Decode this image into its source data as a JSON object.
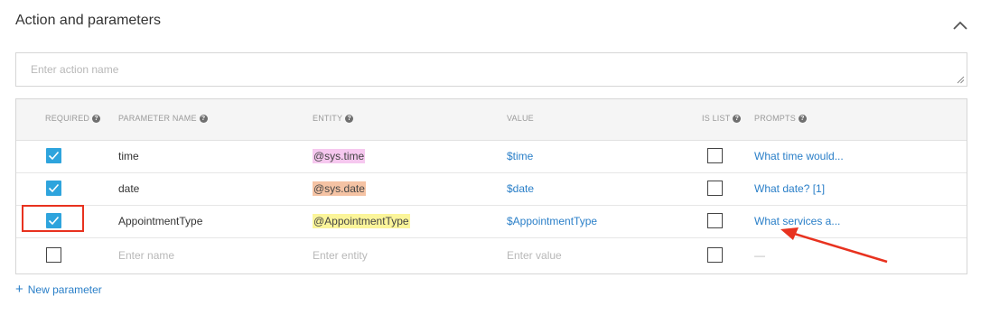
{
  "section": {
    "title": "Action and parameters"
  },
  "action": {
    "placeholder": "Enter action name"
  },
  "table": {
    "headers": {
      "required": "REQUIRED",
      "parameter_name": "PARAMETER NAME",
      "entity": "ENTITY",
      "value": "VALUE",
      "is_list": "IS LIST",
      "prompts": "PROMPTS"
    },
    "rows": [
      {
        "required": true,
        "name": "time",
        "entity": "@sys.time",
        "entity_color": "#f6c8ef",
        "value": "$time",
        "is_list": false,
        "prompt": "What time would..."
      },
      {
        "required": true,
        "name": "date",
        "entity": "@sys.date",
        "entity_color": "#f5c3a4",
        "value": "$date",
        "is_list": false,
        "prompt": "What date? [1]"
      },
      {
        "required": true,
        "name": "AppointmentType",
        "entity": "@AppointmentType",
        "entity_color": "#fbf59a",
        "value": "$AppointmentType",
        "is_list": false,
        "prompt": "What services a..."
      }
    ],
    "new_row": {
      "name_placeholder": "Enter name",
      "entity_placeholder": "Enter entity",
      "value_placeholder": "Enter value",
      "prompt_placeholder": "—"
    }
  },
  "new_parameter_label": "New parameter",
  "colors": {
    "accent": "#2ea4dd",
    "link": "#2a7fc8",
    "annotation": "#e8321f"
  }
}
